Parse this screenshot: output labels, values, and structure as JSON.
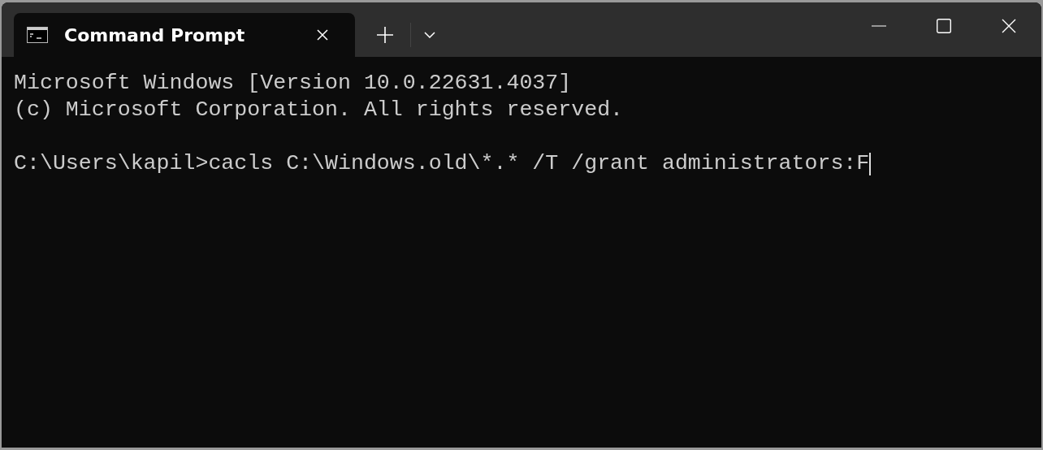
{
  "tabs": [
    {
      "label": "Command Prompt",
      "selected": true
    }
  ],
  "terminal": {
    "output": [
      "Microsoft Windows [Version 10.0.22631.4037]",
      "(c) Microsoft Corporation. All rights reserved."
    ],
    "prompt_line": {
      "text": "C:\\Users\\kapil>cacls C:\\Windows.old\\*.* /T /grant administrators:F",
      "cursor": true
    }
  }
}
